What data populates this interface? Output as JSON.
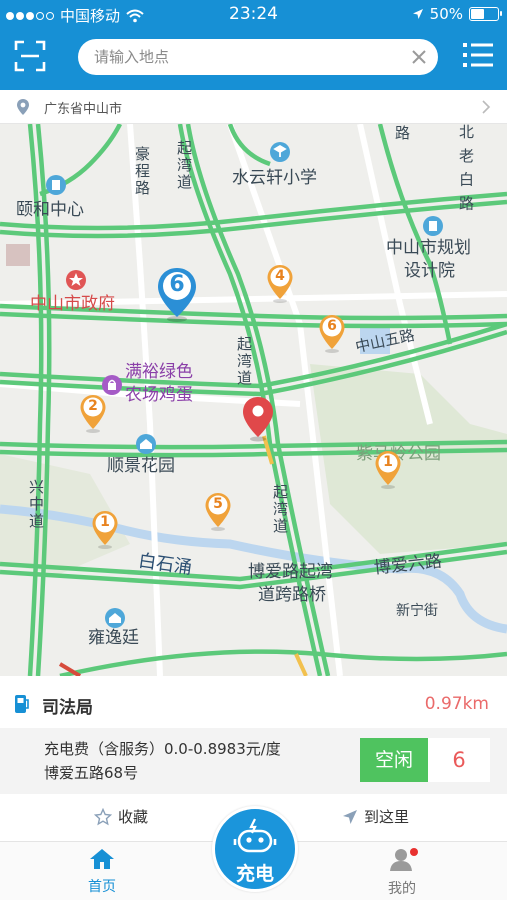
{
  "status_bar": {
    "carrier": "中国移动",
    "time": "23:24",
    "battery": "50%"
  },
  "header": {
    "search_placeholder": "请输入地点",
    "icons": [
      "scan-icon",
      "clear-icon",
      "list-menu-icon"
    ]
  },
  "location": {
    "city": "广东省中山市"
  },
  "map": {
    "labels": {
      "shuiyunxuan": "水云轩小学",
      "yihe": "颐和中心",
      "haocheng": "豪程路",
      "qiwan_top": "起湾道",
      "guihua1": "中山市规划",
      "guihua2": "设计院",
      "government": "中山市政府",
      "zhongshan5": "中山五路",
      "manyu1": "满裕绿色",
      "manyu2": "农场鸡蛋",
      "qiwan_mid": "起湾道",
      "shunjing": "顺景花园",
      "zijinling": "紫马岭公园",
      "xingzhong": "兴中道",
      "qiwan_low": "起湾道",
      "baishiyong": "白石涌",
      "boai1": "博爱路起湾",
      "boai2": "道跨路桥",
      "boai6": "博爱六路",
      "xinning": "新宁街",
      "yongyiting": "雍逸廷",
      "top_right_a": "路",
      "top_right_b": "北\n老\n白\n路"
    },
    "station_markers": [
      {
        "count": "6",
        "kind": "selected"
      },
      {
        "count": "4"
      },
      {
        "count": "6"
      },
      {
        "count": "2"
      },
      {
        "count": "1"
      },
      {
        "count": "5"
      },
      {
        "count": "1"
      }
    ]
  },
  "station": {
    "name": "司法局",
    "distance": "0.97km",
    "fee": "充电费（含服务）0.0-0.8983元/度",
    "address": "博爱五路68号",
    "status": "空闲",
    "available": "6",
    "actions": {
      "favorite": "收藏",
      "navigate": "到这里"
    }
  },
  "tabbar": {
    "home": "首页",
    "charge": "充电",
    "mine": "我的"
  },
  "colors": {
    "brand_blue": "#1790d5",
    "status_green": "#4fc35f",
    "distance_red": "#ea6a6a",
    "marker_orange": "#f0a23a"
  }
}
